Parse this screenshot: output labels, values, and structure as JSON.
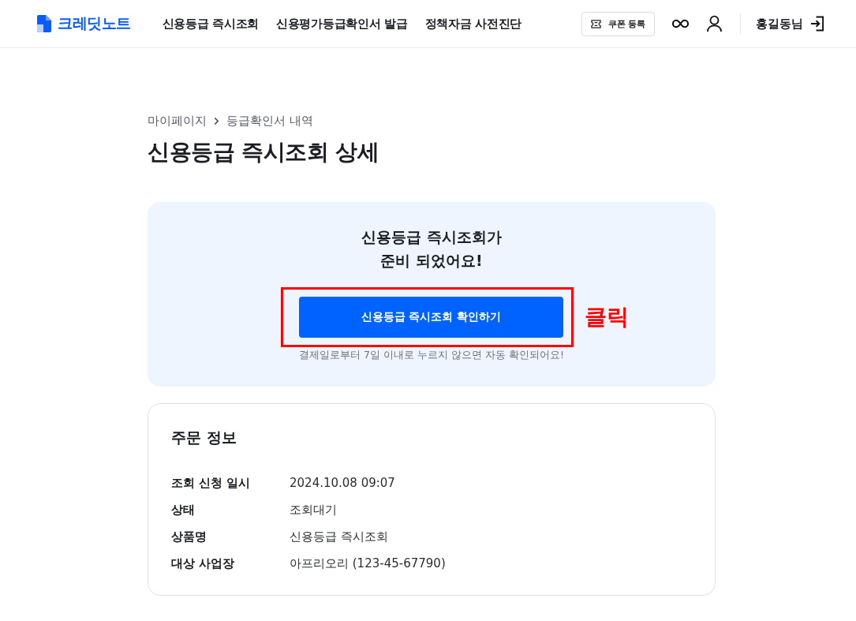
{
  "header": {
    "logo": "크레딧노트",
    "nav": [
      {
        "label": "신용등급 즉시조회"
      },
      {
        "label": "신용평가등급확인서 발급"
      },
      {
        "label": "정책자금 사전진단"
      }
    ],
    "coupon_button": "쿠폰 등록",
    "user_name": "홍길동님"
  },
  "breadcrumb": [
    "마이페이지",
    "등급확인서 내역"
  ],
  "page_title": "신용등급 즉시조회 상세",
  "notice_card": {
    "message": "신용등급 즉시조회가\n준비 되었어요!",
    "button": "신용등급 즉시조회 확인하기",
    "annotation": "클릭",
    "note": "결제일로부터 7일 이내로 누르지 않으면 자동 확인되어요!"
  },
  "order_info": {
    "title": "주문 정보",
    "rows": [
      {
        "label": "조회 신청 일시",
        "value": "2024.10.08 09:07"
      },
      {
        "label": "상태",
        "value": "조회대기"
      },
      {
        "label": "상품명",
        "value": "신용등급 즉시조회"
      },
      {
        "label": "대상 사업장",
        "value": "아프리오리 (123-45-67790)"
      }
    ]
  }
}
